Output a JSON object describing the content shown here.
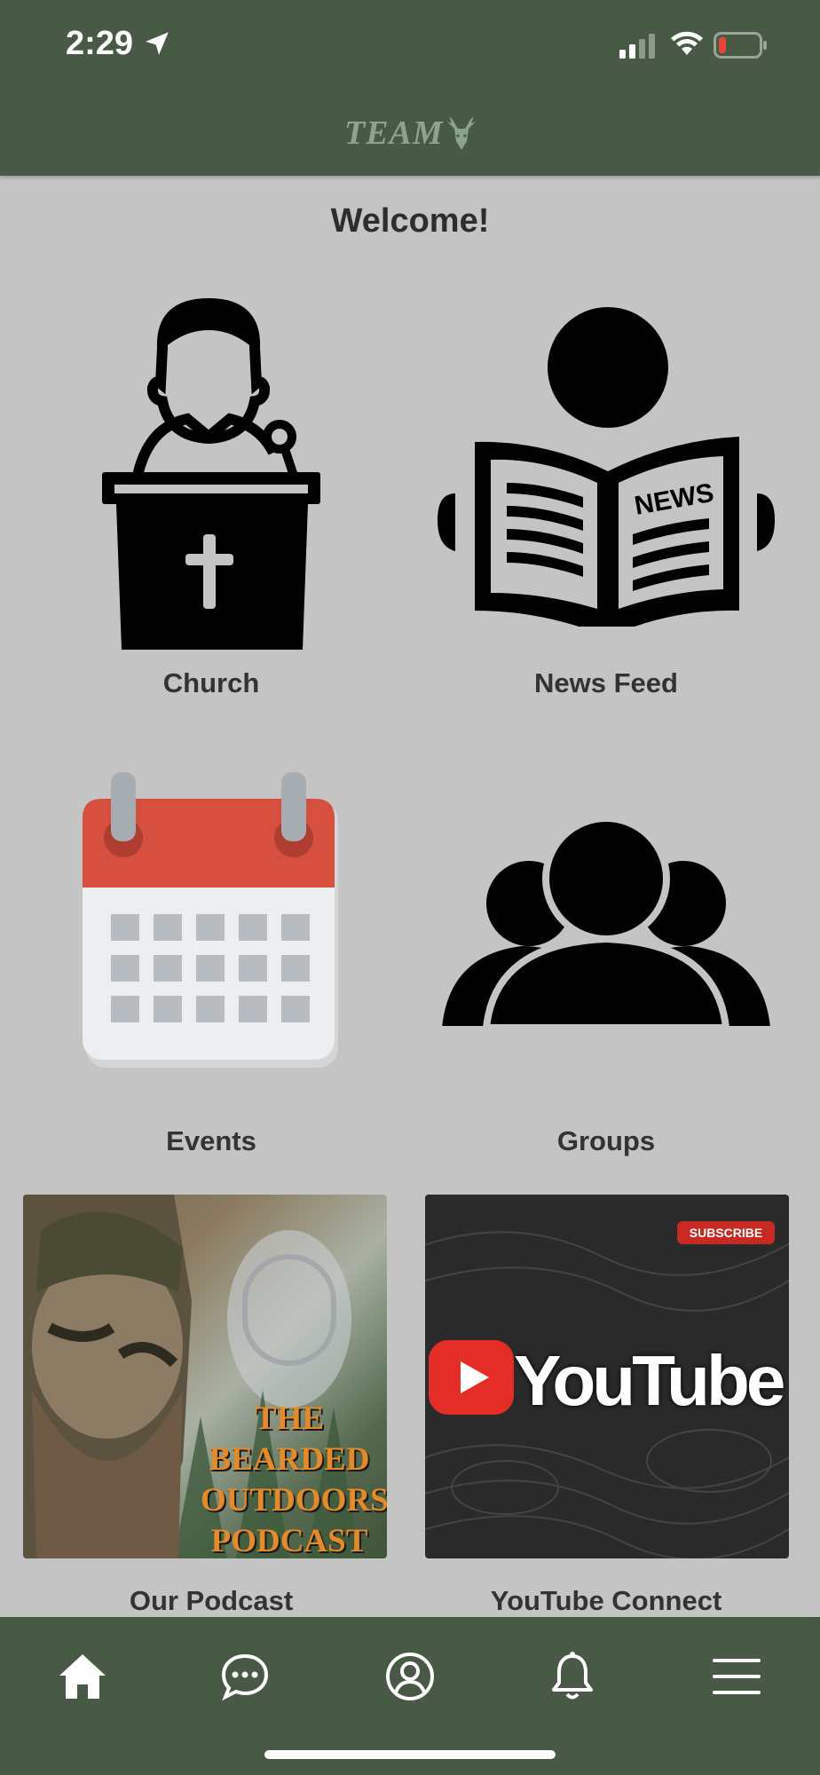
{
  "status_bar": {
    "time": "2:29"
  },
  "header": {
    "logo_text": "TEAM"
  },
  "welcome": "Welcome!",
  "tiles": [
    {
      "label": "Church",
      "icon": "pulpit-icon"
    },
    {
      "label": "News Feed",
      "icon": "newspaper-icon"
    },
    {
      "label": "Events",
      "icon": "calendar-icon"
    },
    {
      "label": "Groups",
      "icon": "group-icon"
    },
    {
      "label": "Our Podcast",
      "image_text": [
        "THE",
        "BEARDED",
        "OUTDOORS",
        "PODCAST"
      ]
    },
    {
      "label": "YouTube Connect",
      "image_text": "YouTube",
      "badge": "SUBSCRIBE"
    }
  ],
  "bottom_nav": [
    "home-icon",
    "chat-icon",
    "profile-icon",
    "bell-icon",
    "menu-icon"
  ],
  "colors": {
    "header": "#485945",
    "background": "#c4c4c4",
    "youtube_red": "#e52d27"
  }
}
